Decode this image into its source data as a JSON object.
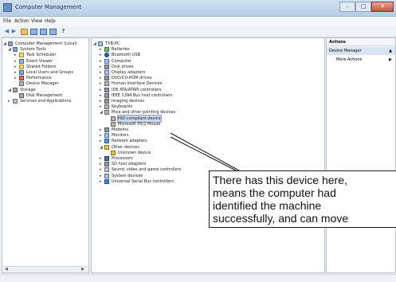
{
  "window": {
    "title": "Computer Management"
  },
  "menu": [
    "File",
    "Action",
    "View",
    "Help"
  ],
  "left_tree": [
    {
      "label": "Computer Management (Local)",
      "icon": "computer-management-icon",
      "color": "c-gear"
    },
    {
      "label": "System Tools",
      "icon": "system-tools-icon",
      "color": "c-gear"
    },
    {
      "label": "Task Scheduler",
      "icon": "task-scheduler-icon",
      "color": "c-cal"
    },
    {
      "label": "Event Viewer",
      "icon": "event-viewer-icon",
      "color": "c-eye"
    },
    {
      "label": "Shared Folders",
      "icon": "shared-folders-icon",
      "color": "c-fold"
    },
    {
      "label": "Local Users and Groups",
      "icon": "users-icon",
      "color": "c-users"
    },
    {
      "label": "Performance",
      "icon": "performance-icon",
      "color": "c-perf"
    },
    {
      "label": "Device Manager",
      "icon": "device-manager-icon",
      "color": "c-dev"
    },
    {
      "label": "Storage",
      "icon": "storage-icon",
      "color": "c-disk"
    },
    {
      "label": "Disk Management",
      "icon": "disk-management-icon",
      "color": "c-disk"
    },
    {
      "label": "Services and Applications",
      "icon": "services-icon",
      "color": "c-svc"
    }
  ],
  "device_tree": [
    {
      "label": "TXB-PC",
      "icon": "computer-icon",
      "color": "c-pc"
    },
    {
      "label": "Batteries",
      "icon": "battery-icon",
      "color": "c-batt"
    },
    {
      "label": "Bluetooth USB",
      "icon": "bluetooth-icon",
      "color": "c-bt"
    },
    {
      "label": "Computer",
      "icon": "computer-icon",
      "color": "c-pc"
    },
    {
      "label": "Disk drives",
      "icon": "disk-drive-icon",
      "color": "c-hw"
    },
    {
      "label": "Display adapters",
      "icon": "display-adapter-icon",
      "color": "c-pc"
    },
    {
      "label": "DVD/CD-ROM drives",
      "icon": "dvd-drive-icon",
      "color": "c-hw"
    },
    {
      "label": "Human Interface Devices",
      "icon": "hid-icon",
      "color": "c-hid"
    },
    {
      "label": "IDE ATA/ATAPI controllers",
      "icon": "ide-controller-icon",
      "color": "c-hw"
    },
    {
      "label": "IEEE 1394 Bus host controllers",
      "icon": "ieee1394-icon",
      "color": "c-hw"
    },
    {
      "label": "Imaging devices",
      "icon": "imaging-device-icon",
      "color": "c-hw"
    },
    {
      "label": "Keyboards",
      "icon": "keyboard-icon",
      "color": "c-hid"
    },
    {
      "label": "Mice and other pointing devices",
      "icon": "mouse-icon",
      "color": "c-hid"
    },
    {
      "label": "HID-compliant device",
      "icon": "mouse-icon",
      "color": "c-hid"
    },
    {
      "label": "Microsoft PS/2 Mouse",
      "icon": "mouse-icon",
      "color": "c-hid"
    },
    {
      "label": "Modems",
      "icon": "modem-icon",
      "color": "c-hw"
    },
    {
      "label": "Monitors",
      "icon": "monitor-icon",
      "color": "c-pc"
    },
    {
      "label": "Network adapters",
      "icon": "network-adapter-icon",
      "color": "c-net"
    },
    {
      "label": "Other devices",
      "icon": "other-devices-icon",
      "color": "c-warn"
    },
    {
      "label": "Unknown device",
      "icon": "warning-icon",
      "color": "c-warn"
    },
    {
      "label": "Processors",
      "icon": "processor-icon",
      "color": "c-cpu"
    },
    {
      "label": "SD host adapters",
      "icon": "sd-adapter-icon",
      "color": "c-hw"
    },
    {
      "label": "Sound, video and game controllers",
      "icon": "sound-icon",
      "color": "c-snd"
    },
    {
      "label": "System devices",
      "icon": "system-devices-icon",
      "color": "c-pc"
    },
    {
      "label": "Universal Serial Bus controllers",
      "icon": "usb-icon",
      "color": "c-usb"
    }
  ],
  "actions": {
    "header": "Actions",
    "section": "Device Manager",
    "more": "More Actions"
  },
  "callout": {
    "text": "There has this device here,\nmeans the computer had\nidentified the machine\nsuccessfully, and can move\nnext step for software online"
  }
}
